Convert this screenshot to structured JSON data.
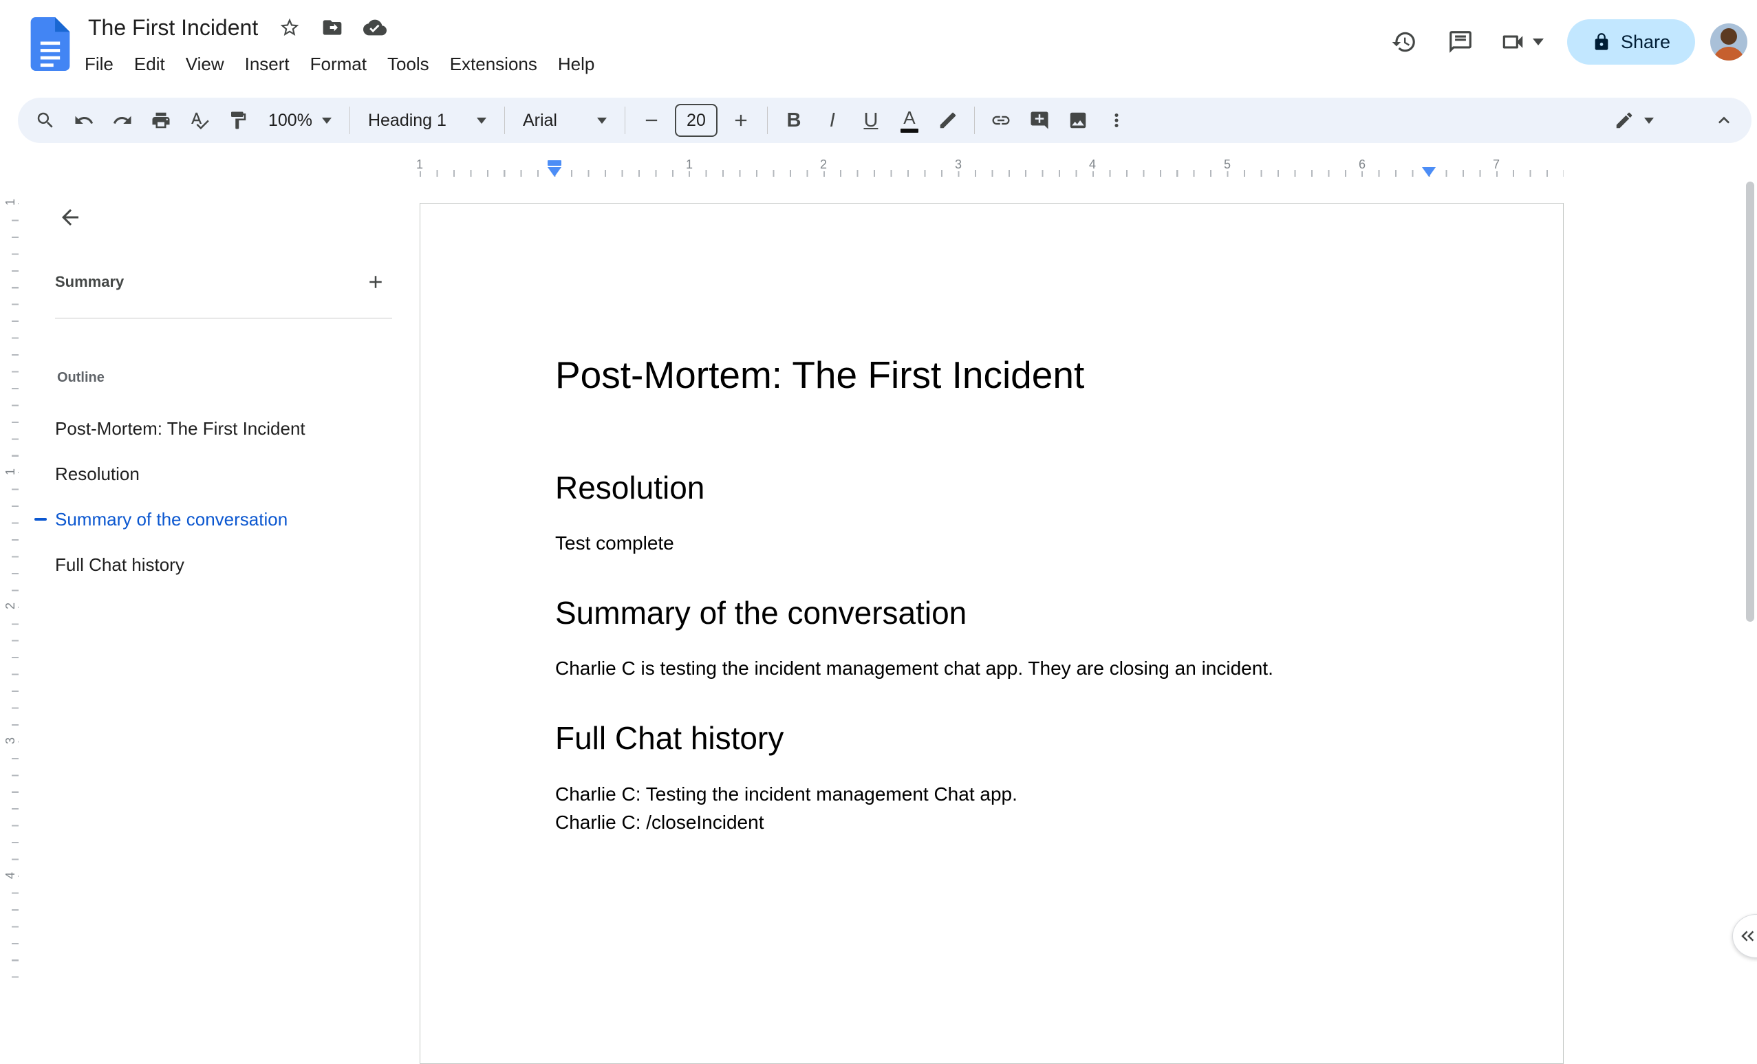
{
  "header": {
    "title": "The First Incident",
    "menus": [
      "File",
      "Edit",
      "View",
      "Insert",
      "Format",
      "Tools",
      "Extensions",
      "Help"
    ],
    "share_label": "Share"
  },
  "toolbar": {
    "zoom_value": "100%",
    "paragraph_style": "Heading 1",
    "font_family": "Arial",
    "font_size": "20",
    "bold_glyph": "B",
    "italic_glyph": "I",
    "underline_glyph": "U",
    "text_color_glyph": "A"
  },
  "ruler": {
    "h_labels": [
      "1",
      "1",
      "2",
      "3",
      "4",
      "5",
      "6",
      "7"
    ],
    "v_labels": [
      "1",
      "1",
      "2",
      "3",
      "4"
    ]
  },
  "sidebar": {
    "summary_label": "Summary",
    "outline_label": "Outline",
    "outline_items": [
      {
        "label": "Post-Mortem: The First Incident",
        "active": false
      },
      {
        "label": "Resolution",
        "active": false
      },
      {
        "label": "Summary of the conversation",
        "active": true
      },
      {
        "label": "Full Chat history",
        "active": false
      }
    ]
  },
  "document": {
    "heading1": "Post-Mortem: The First Incident",
    "sections": [
      {
        "heading": "Resolution",
        "lines": [
          "Test complete"
        ]
      },
      {
        "heading": "Summary of the conversation",
        "lines": [
          "Charlie C is testing the incident management chat app. They are closing an incident."
        ]
      },
      {
        "heading": "Full Chat history",
        "lines": [
          "Charlie C: Testing the incident management Chat app.",
          "Charlie C: /closeIncident"
        ]
      }
    ]
  },
  "colors": {
    "accent_blue": "#0b57d0",
    "share_bg": "#c2e7ff",
    "share_text": "#001d35",
    "toolbar_bg": "#edf2fa",
    "icon_gray": "#444746",
    "marker_blue": "#4c8df6"
  }
}
